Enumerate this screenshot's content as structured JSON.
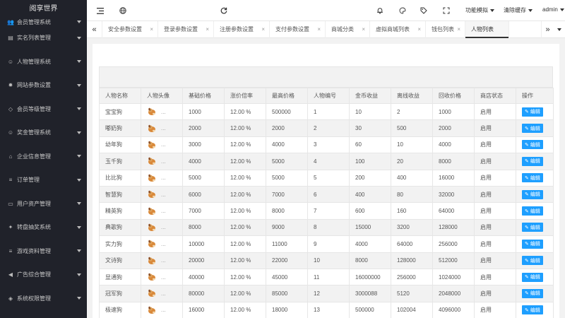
{
  "brand": "阅享世界",
  "sidebar": {
    "items": [
      {
        "label": "会员管理系统",
        "icon": "users-icon"
      },
      {
        "label": "实名列表管理",
        "icon": "id-card-icon"
      },
      {
        "label": "人物管理系统",
        "icon": "person-icon"
      },
      {
        "label": "网站参数设置",
        "icon": "gear-icon"
      },
      {
        "label": "会员等级管理",
        "icon": "diamond-icon"
      },
      {
        "label": "奖金管理系统",
        "icon": "smile-icon"
      },
      {
        "label": "企业信息管理",
        "icon": "building-icon"
      },
      {
        "label": "订单管理",
        "icon": "list-icon"
      },
      {
        "label": "用户资产管理",
        "icon": "wallet-icon"
      },
      {
        "label": "转盘抽奖系统",
        "icon": "wheel-icon"
      },
      {
        "label": "游戏资料管理",
        "icon": "menu-icon"
      },
      {
        "label": "广告综合管理",
        "icon": "megaphone-icon"
      },
      {
        "label": "系统权限管理",
        "icon": "shield-icon"
      }
    ]
  },
  "topbar": {
    "mode_label": "功能模拟",
    "clear_cache_label": "清除缓存",
    "user_label": "admin"
  },
  "tabs": [
    {
      "label": "安全参数设置",
      "closable": true
    },
    {
      "label": "登录参数设置",
      "closable": true
    },
    {
      "label": "注册参数设置",
      "closable": true
    },
    {
      "label": "支付参数设置",
      "closable": true
    },
    {
      "label": "商城分类",
      "closable": true
    },
    {
      "label": "虚拟商城列表",
      "closable": true
    },
    {
      "label": "钱包列表",
      "closable": true
    },
    {
      "label": "人物列表",
      "closable": false,
      "active": true
    }
  ],
  "table": {
    "columns": [
      "人物名称",
      "人物头像",
      "基础价格",
      "涨价倍率",
      "最高价格",
      "人物编号",
      "金币收益",
      "离线收益",
      "回收价格",
      "商店状态",
      "操作"
    ],
    "edit_label": "编辑",
    "avatar_ellipsis": "...",
    "rows": [
      [
        "宝宝狗",
        "",
        "1000",
        "12.00 %",
        "500000",
        "1",
        "10",
        "2",
        "1000",
        "启用"
      ],
      [
        "嘟奶狗",
        "",
        "2000",
        "12.00 %",
        "2000",
        "2",
        "30",
        "500",
        "2000",
        "启用"
      ],
      [
        "幼年狗",
        "",
        "3000",
        "12.00 %",
        "4000",
        "3",
        "60",
        "10",
        "4000",
        "启用"
      ],
      [
        "玉千狗",
        "",
        "4000",
        "12.00 %",
        "5000",
        "4",
        "100",
        "20",
        "8000",
        "启用"
      ],
      [
        "比比狗",
        "",
        "5000",
        "12.00 %",
        "5000",
        "5",
        "200",
        "400",
        "16000",
        "启用"
      ],
      [
        "智慧狗",
        "",
        "6000",
        "12.00 %",
        "7000",
        "6",
        "400",
        "80",
        "32000",
        "启用"
      ],
      [
        "精英狗",
        "",
        "7000",
        "12.00 %",
        "8000",
        "7",
        "600",
        "160",
        "64000",
        "启用"
      ],
      [
        "典歌狗",
        "",
        "8000",
        "12.00 %",
        "9000",
        "8",
        "15000",
        "3200",
        "128000",
        "启用"
      ],
      [
        "实力狗",
        "",
        "10000",
        "12.00 %",
        "11000",
        "9",
        "4000",
        "64000",
        "256000",
        "启用"
      ],
      [
        "文诗狗",
        "",
        "20000",
        "12.00 %",
        "22000",
        "10",
        "8000",
        "128000",
        "512000",
        "启用"
      ],
      [
        "显通狗",
        "",
        "40000",
        "12.00 %",
        "45000",
        "11",
        "16000000",
        "256000",
        "1024000",
        "启用"
      ],
      [
        "冠军狗",
        "",
        "80000",
        "12.00 %",
        "85000",
        "12",
        "3000088",
        "5120",
        "2048000",
        "启用"
      ],
      [
        "极速狗",
        "",
        "16000",
        "12.00 %",
        "18000",
        "13",
        "500000",
        "102004",
        "4096000",
        "启用"
      ]
    ]
  }
}
